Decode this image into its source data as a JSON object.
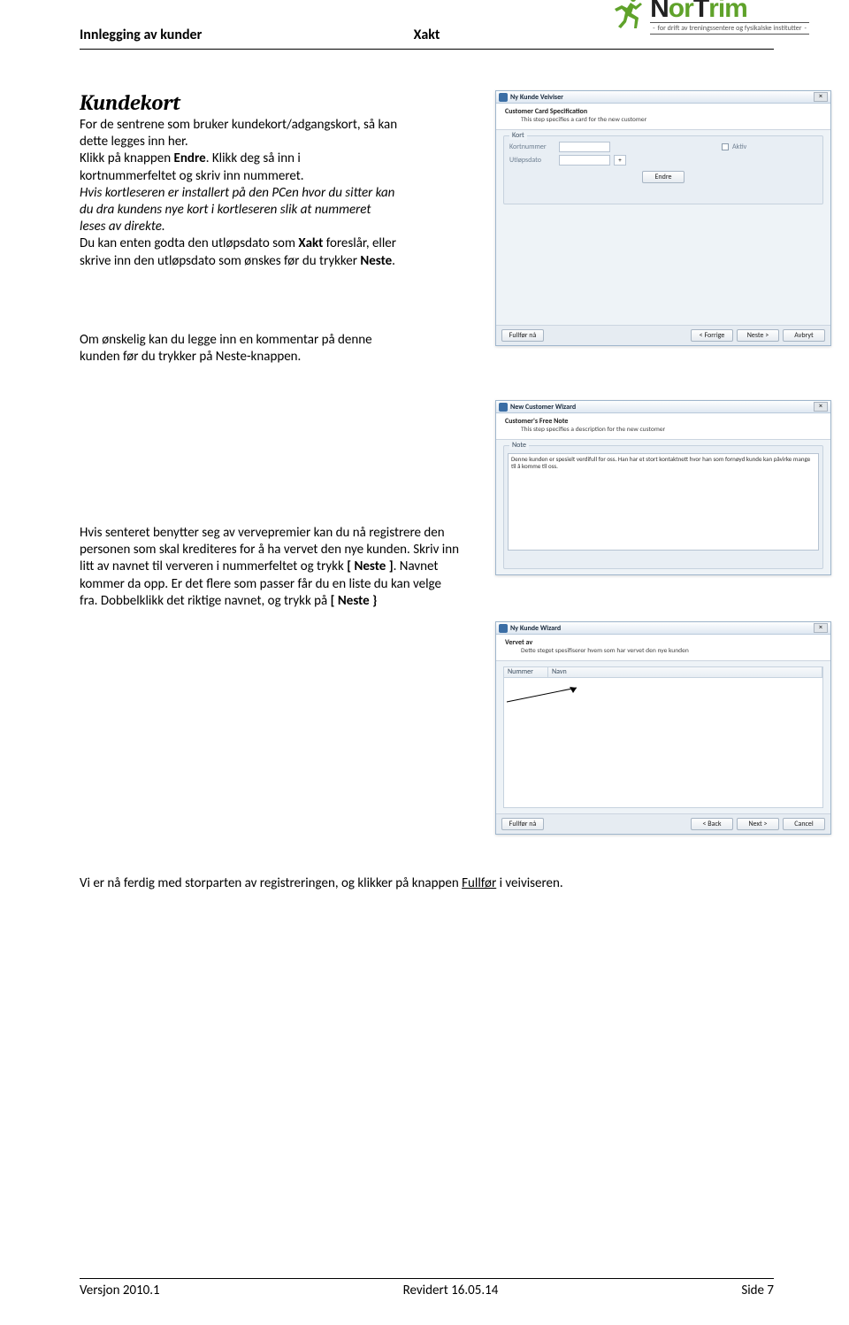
{
  "header": {
    "left": "Innlegging av kunder",
    "mid": "Xakt",
    "logo": {
      "name": "NorTrim",
      "sub_pre": "-",
      "sub_text": "for drift av treningssentere og fysikalske institutter",
      "sub_post": "-"
    }
  },
  "section_title": "Kundekort",
  "p1": {
    "t1": "For de sentrene som bruker kundekort/adgangskort, så kan dette legges inn her.",
    "t2_a": "Klikk på knappen ",
    "t2_b": "Endre",
    "t2_c": ". Klikk deg så inn i kortnummerfeltet og skriv inn nummeret.",
    "t3": "Hvis kortleseren er installert på den PCen hvor du sitter kan du dra kundens nye kort i kortleseren slik at nummeret leses av direkte.",
    "t4_a": "Du kan enten godta den utløpsdato som ",
    "t4_b": "Xakt",
    "t4_c": " foreslår, eller skrive inn den utløpsdato som ønskes før du trykker ",
    "t4_d": "Neste",
    "t4_e": "."
  },
  "p2": "Om ønskelig kan du legge inn en kommentar på denne kunden før du trykker på Neste-knappen.",
  "p3": {
    "a": "Hvis senteret benytter seg av vervepremier kan du nå registrere den personen som skal krediteres for å ha vervet den nye kunden. Skriv inn litt av navnet til ververen i nummerfeltet og trykk",
    "b": "[ Neste ]",
    "c": ". Navnet kommer da opp. Er det flere som passer får du en liste du kan velge fra. Dobbelklikk det riktige navnet, og trykk på",
    "d": "[ Neste }"
  },
  "p4": {
    "a": "Vi er nå ferdig med storparten av registreringen, og klikker på knappen ",
    "b": "Fullfør",
    "c": " i veiviseren."
  },
  "win1": {
    "title": "Ny Kunde Veiviser",
    "desc_title": "Customer Card Specification",
    "desc_sub": "This step specifies a card for the new customer",
    "group": "Kort",
    "lbl_kortnr": "Kortnummer",
    "lbl_utlop": "Utløpsdato",
    "lbl_aktiv": "Aktiv",
    "btn_plus": "+",
    "btn_endre": "Endre",
    "btn_fullfor": "Fullfør nå",
    "btn_back": "< Forrige",
    "btn_next": "Neste >",
    "btn_cancel": "Avbryt"
  },
  "win2": {
    "title": "New Customer Wizard",
    "desc_title": "Customer's Free Note",
    "desc_sub": "This step specifies a description for the new customer",
    "group": "Note",
    "note_text": "Denne kunden er spesielt verdifull for oss. Han har et stort kontaktnett hvor han som fornøyd kunde kan påvirke mange til å komme til oss."
  },
  "win3": {
    "title": "Ny Kunde Wizard",
    "desc_title": "Vervet av",
    "desc_sub": "Dette steget spesifiserer hvem som har vervet den nye kunden",
    "col1": "Nummer",
    "col2": "Navn",
    "btn_fullfor": "Fullfør nå",
    "btn_back": "< Back",
    "btn_next": "Next >",
    "btn_cancel": "Cancel"
  },
  "footer": {
    "left": "Versjon 2010.1",
    "mid": "Revidert 16.05.14",
    "right": "Side 7"
  }
}
